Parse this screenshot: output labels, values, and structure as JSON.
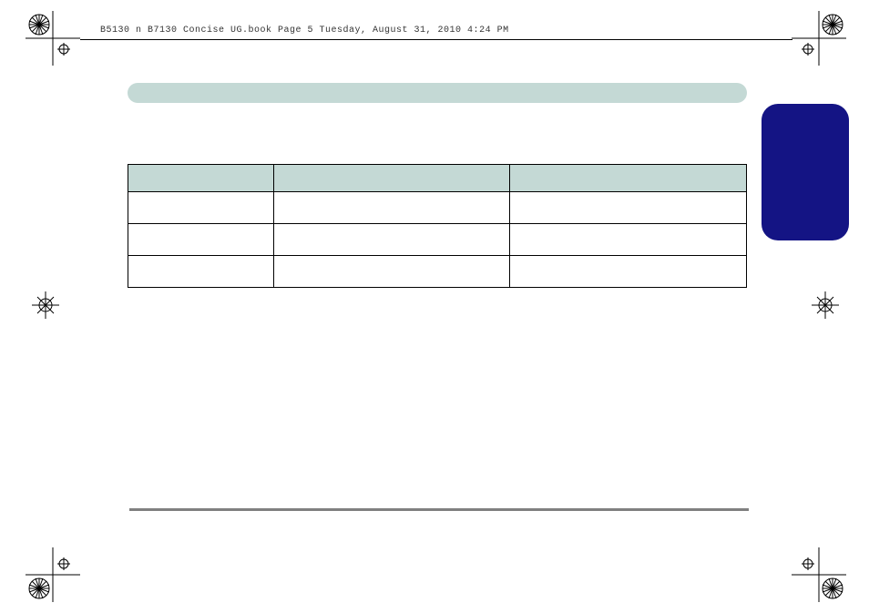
{
  "header": {
    "text": "B5130 n B7130 Concise UG.book  Page 5  Tuesday, August 31, 2010  4:24 PM"
  }
}
